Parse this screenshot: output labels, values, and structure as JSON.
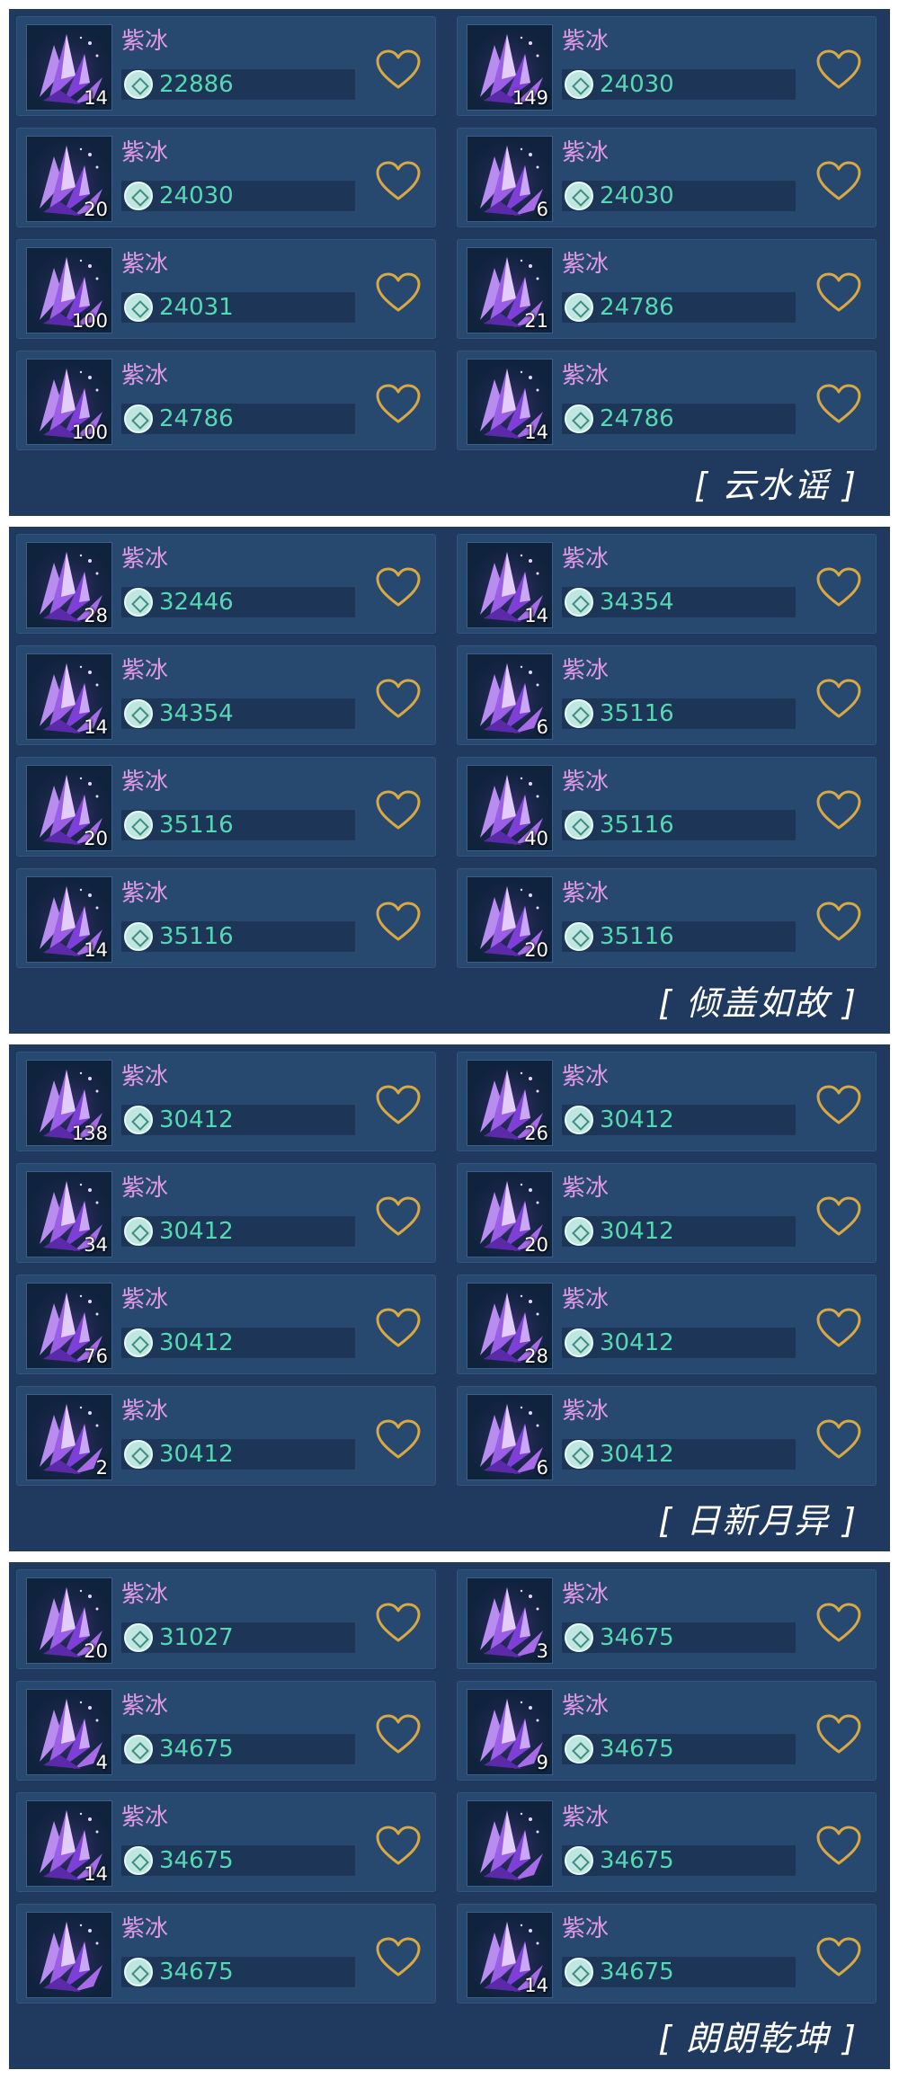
{
  "colors": {
    "panel_bg": "#1f3a5e",
    "card_bg": "#27486f",
    "item_name": "#e29ae8",
    "price": "#56d8b2",
    "heart_outline": "#d7a843",
    "tag_text": "#ffffff"
  },
  "icons": {
    "item": "purple-crystal-icon",
    "currency": "silver-coin-icon",
    "favorite": "heart-outline-icon"
  },
  "panels": [
    {
      "server_tag": "[ 云水谣 ]",
      "items": [
        {
          "name": "紫冰",
          "qty": "14",
          "price": "22886"
        },
        {
          "name": "紫冰",
          "qty": "149",
          "price": "24030"
        },
        {
          "name": "紫冰",
          "qty": "20",
          "price": "24030"
        },
        {
          "name": "紫冰",
          "qty": "6",
          "price": "24030"
        },
        {
          "name": "紫冰",
          "qty": "100",
          "price": "24031"
        },
        {
          "name": "紫冰",
          "qty": "21",
          "price": "24786"
        },
        {
          "name": "紫冰",
          "qty": "100",
          "price": "24786"
        },
        {
          "name": "紫冰",
          "qty": "14",
          "price": "24786"
        }
      ]
    },
    {
      "server_tag": "[ 倾盖如故 ]",
      "items": [
        {
          "name": "紫冰",
          "qty": "28",
          "price": "32446"
        },
        {
          "name": "紫冰",
          "qty": "14",
          "price": "34354"
        },
        {
          "name": "紫冰",
          "qty": "14",
          "price": "34354"
        },
        {
          "name": "紫冰",
          "qty": "6",
          "price": "35116"
        },
        {
          "name": "紫冰",
          "qty": "20",
          "price": "35116"
        },
        {
          "name": "紫冰",
          "qty": "40",
          "price": "35116"
        },
        {
          "name": "紫冰",
          "qty": "14",
          "price": "35116"
        },
        {
          "name": "紫冰",
          "qty": "20",
          "price": "35116"
        }
      ]
    },
    {
      "server_tag": "[ 日新月异 ]",
      "items": [
        {
          "name": "紫冰",
          "qty": "138",
          "price": "30412"
        },
        {
          "name": "紫冰",
          "qty": "26",
          "price": "30412"
        },
        {
          "name": "紫冰",
          "qty": "34",
          "price": "30412"
        },
        {
          "name": "紫冰",
          "qty": "20",
          "price": "30412"
        },
        {
          "name": "紫冰",
          "qty": "76",
          "price": "30412"
        },
        {
          "name": "紫冰",
          "qty": "28",
          "price": "30412"
        },
        {
          "name": "紫冰",
          "qty": "2",
          "price": "30412"
        },
        {
          "name": "紫冰",
          "qty": "6",
          "price": "30412"
        }
      ]
    },
    {
      "server_tag": "[ 朗朗乾坤 ]",
      "items": [
        {
          "name": "紫冰",
          "qty": "20",
          "price": "31027"
        },
        {
          "name": "紫冰",
          "qty": "3",
          "price": "34675"
        },
        {
          "name": "紫冰",
          "qty": "4",
          "price": "34675"
        },
        {
          "name": "紫冰",
          "qty": "9",
          "price": "34675"
        },
        {
          "name": "紫冰",
          "qty": "14",
          "price": "34675"
        },
        {
          "name": "紫冰",
          "qty": "",
          "price": "34675"
        },
        {
          "name": "紫冰",
          "qty": "",
          "price": "34675"
        },
        {
          "name": "紫冰",
          "qty": "14",
          "price": "34675"
        }
      ]
    }
  ]
}
